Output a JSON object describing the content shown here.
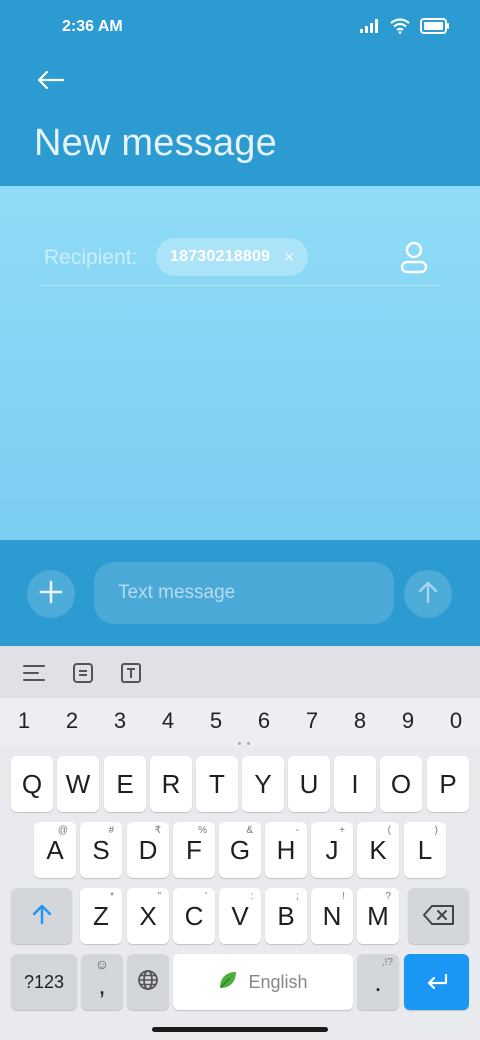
{
  "status": {
    "time": "2:36 AM"
  },
  "header": {
    "title": "New message"
  },
  "recipient": {
    "label": "Recipient:",
    "chip": "18730218809"
  },
  "compose": {
    "placeholder": "Text message"
  },
  "keyboard": {
    "numbers": [
      "1",
      "2",
      "3",
      "4",
      "5",
      "6",
      "7",
      "8",
      "9",
      "0"
    ],
    "row1": [
      "Q",
      "W",
      "E",
      "R",
      "T",
      "Y",
      "U",
      "I",
      "O",
      "P"
    ],
    "row2": [
      "A",
      "S",
      "D",
      "F",
      "G",
      "H",
      "J",
      "K",
      "L"
    ],
    "row2_hints": [
      "@",
      "#",
      "₹",
      "%",
      "&",
      "-",
      "+",
      "(",
      ")"
    ],
    "row3": [
      "Z",
      "X",
      "C",
      "V",
      "B",
      "N",
      "M"
    ],
    "row3_hints": [
      "*",
      "\"",
      "'",
      ":",
      ";",
      "!",
      "?"
    ],
    "symbols_label": "?123",
    "comma": ",",
    "space_label": "English",
    "period": ".",
    "period_hint": ",!?"
  },
  "colors": {
    "accent": "#2b9bd1",
    "content_top": "#90dcf7",
    "enter": "#1a96f5"
  }
}
